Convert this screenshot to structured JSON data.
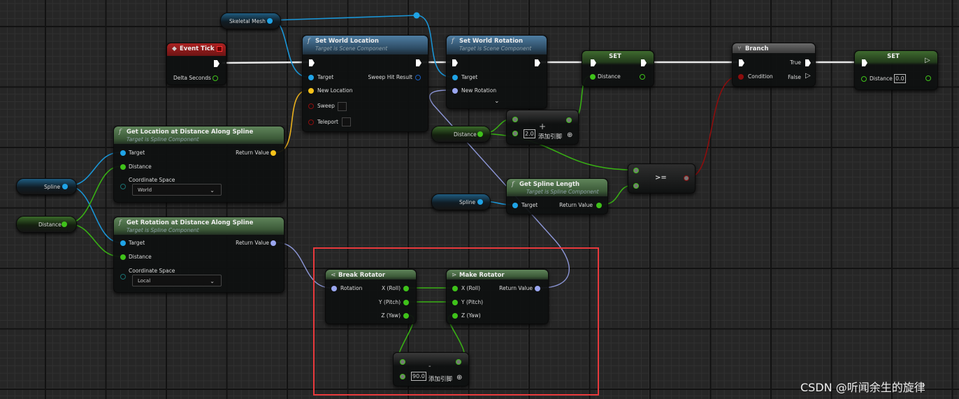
{
  "variables": {
    "skeletal_mesh": "Skeletal Mesh",
    "spline": "Spline",
    "distance": "Distance"
  },
  "event_tick": {
    "title": "Event Tick",
    "delta_seconds": "Delta Seconds"
  },
  "set_world_location": {
    "title": "Set World Location",
    "subtitle": "Target is Scene Component",
    "target": "Target",
    "new_location": "New Location",
    "sweep": "Sweep",
    "teleport": "Teleport",
    "sweep_hit_result": "Sweep Hit Result"
  },
  "set_world_rotation": {
    "title": "Set World Rotation",
    "subtitle": "Target is Scene Component",
    "target": "Target",
    "new_rotation": "New Rotation"
  },
  "set1": {
    "title": "SET",
    "distance": "Distance"
  },
  "branch": {
    "title": "Branch",
    "condition": "Condition",
    "true": "True",
    "false": "False"
  },
  "set2": {
    "title": "SET",
    "distance": "Distance",
    "value": "0.0"
  },
  "add": {
    "symbol": "+",
    "value": "2.0",
    "add_pin": "添加引脚"
  },
  "compare": {
    "symbol": ">="
  },
  "get_spline_length": {
    "title": "Get Spline Length",
    "subtitle": "Target is Spline Component",
    "target": "Target",
    "return_value": "Return Value"
  },
  "get_location": {
    "title": "Get Location at Distance Along Spline",
    "subtitle": "Target is Spline Component",
    "target": "Target",
    "distance": "Distance",
    "coord_space": "Coordinate Space",
    "coord_value": "World",
    "return_value": "Return Value"
  },
  "get_rotation": {
    "title": "Get Rotation at Distance Along Spline",
    "subtitle": "Target is Spline Component",
    "target": "Target",
    "distance": "Distance",
    "coord_space": "Coordinate Space",
    "coord_value": "Local",
    "return_value": "Return Value"
  },
  "break_rotator": {
    "title": "Break Rotator",
    "rotation": "Rotation",
    "x": "X (Roll)",
    "y": "Y (Pitch)",
    "z": "Z (Yaw)"
  },
  "make_rotator": {
    "title": "Make Rotator",
    "x": "X (Roll)",
    "y": "Y (Pitch)",
    "z": "Z (Yaw)",
    "return_value": "Return Value"
  },
  "subtract": {
    "symbol": "-",
    "value": "90.0",
    "add_pin": "添加引脚"
  },
  "watermark": "CSDN @听闻余生的旋律",
  "colors": {
    "exec": "#ffffff",
    "object": "#1fa3e6",
    "float": "#3fc21a",
    "vector": "#f7c21a",
    "rotator": "#9aa6f0",
    "bool": "#8c0d0d",
    "highlight": "#e8393c"
  }
}
